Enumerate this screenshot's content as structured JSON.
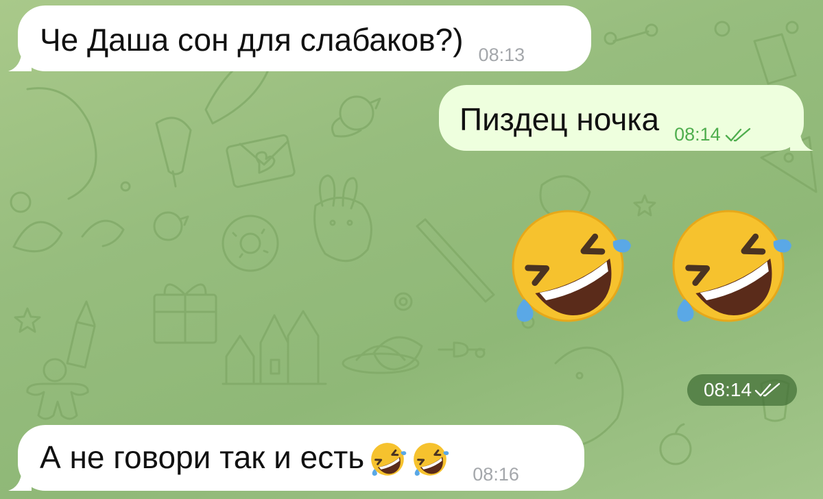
{
  "colors": {
    "wallpaper": "#97bd7e",
    "incoming_bubble": "#ffffff",
    "outgoing_bubble": "#eeffde",
    "outgoing_time": "#4fae4e",
    "incoming_time": "#a4a7ab",
    "time_pill": "#406e34"
  },
  "messages": [
    {
      "direction": "incoming",
      "text": "Че Даша сон для слабаков?)",
      "time": "08:13"
    },
    {
      "direction": "outgoing",
      "text": "Пиздец ночка",
      "time": "08:14",
      "status_icon": "double-check-icon"
    },
    {
      "direction": "outgoing",
      "type": "emoji-sticker",
      "emoji": [
        "rolling-on-floor-laughing",
        "rolling-on-floor-laughing"
      ],
      "time": "08:14",
      "status_icon": "double-check-icon"
    },
    {
      "direction": "incoming",
      "text": "А не говори так и есть",
      "emoji": [
        "rolling-on-floor-laughing",
        "rolling-on-floor-laughing"
      ],
      "time": "08:16"
    }
  ]
}
